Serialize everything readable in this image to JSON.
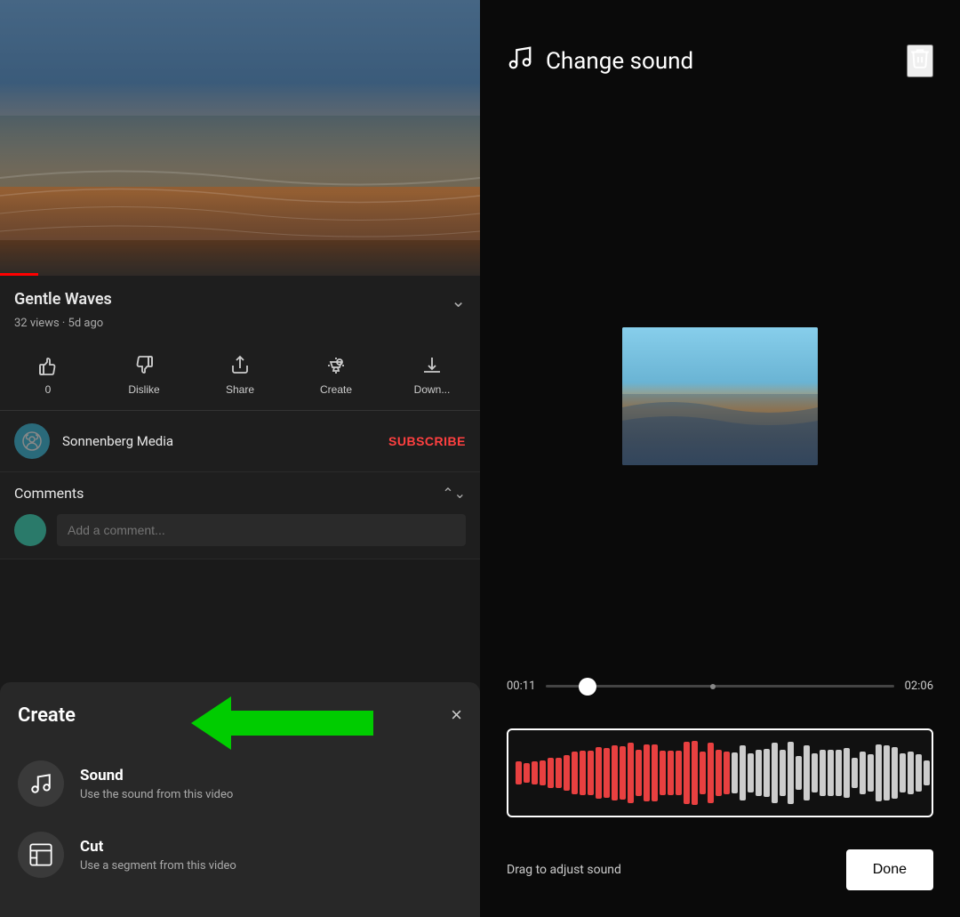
{
  "left": {
    "video": {
      "title": "Gentle Waves",
      "views": "32 views",
      "time_ago": "5d ago",
      "progress_percent": 8
    },
    "actions": [
      {
        "id": "like",
        "icon": "👍",
        "label": "0"
      },
      {
        "id": "dislike",
        "icon": "👎",
        "label": "Dislike"
      },
      {
        "id": "share",
        "icon": "↗",
        "label": "Share"
      },
      {
        "id": "create",
        "icon": "✂",
        "label": "Create"
      },
      {
        "id": "download",
        "icon": "⬇",
        "label": "Down..."
      }
    ],
    "channel": {
      "name": "Sonnenberg Media",
      "subscribe_label": "SUBSCRIBE"
    },
    "comments": {
      "title": "Comments",
      "input_placeholder": "Add a comment..."
    },
    "create_modal": {
      "title": "Create",
      "items": [
        {
          "id": "sound",
          "label": "Sound",
          "description": "Use the sound from this video"
        },
        {
          "id": "cut",
          "label": "Cut",
          "description": "Use a segment from this video"
        }
      ],
      "close_label": "×"
    }
  },
  "right": {
    "header": {
      "title": "Change sound",
      "music_icon": "♫",
      "delete_icon": "🗑"
    },
    "timeline": {
      "start_time": "00:11",
      "end_time": "02:06",
      "thumb_position_pct": 12,
      "dot_position_pct": 48
    },
    "waveform": {
      "bars_left_color": "#e84040",
      "bars_right_color": "#cccccc",
      "split_pct": 45,
      "bar_count": 60
    },
    "footer": {
      "drag_hint": "Drag to adjust sound",
      "done_label": "Done"
    }
  }
}
